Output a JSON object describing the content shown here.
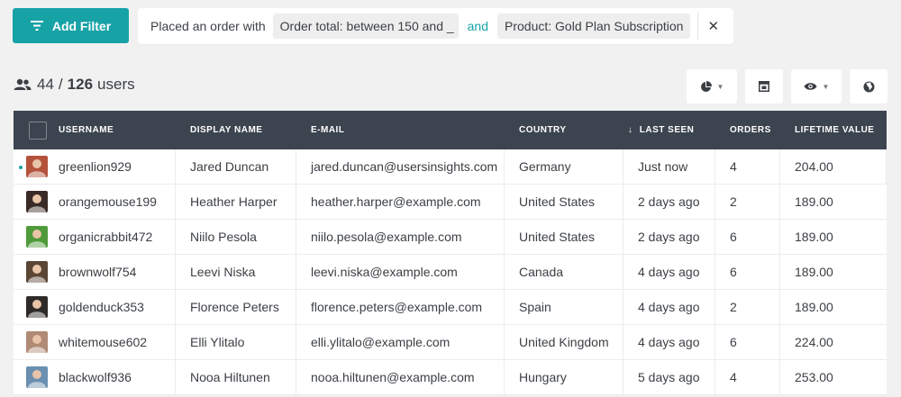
{
  "toolbar": {
    "add_filter_label": "Add Filter"
  },
  "filter": {
    "prefix": "Placed an order with",
    "chips": [
      "Order total: between 150 and _",
      "Product: Gold Plan Subscription"
    ],
    "joiner": "and",
    "close_glyph": "✕"
  },
  "summary": {
    "shown": "44",
    "separator": "/",
    "total": "126",
    "unit": "users"
  },
  "icons": {
    "users": "users-icon",
    "filter": "filter-icon",
    "pie": "pie-chart-icon",
    "columns": "table-layout-icon",
    "eye": "eye-icon",
    "globe": "globe-icon"
  },
  "colors": {
    "accent": "#17a2a6",
    "header_bg": "#3c444f",
    "page_bg": "#f1f1f1"
  },
  "table": {
    "headers": {
      "username": "USERNAME",
      "display_name": "DISPLAY NAME",
      "email": "E-MAIL",
      "country": "COUNTRY",
      "sort_indicator": "↓",
      "last_seen": "LAST SEEN",
      "orders": "ORDERS",
      "lifetime_value": "LIFETIME VALUE"
    },
    "rows": [
      {
        "username": "greenlion929",
        "display_name": "Jared Duncan",
        "email": "jared.duncan@usersinsights.com",
        "country": "Germany",
        "last_seen": "Just now",
        "orders": "4",
        "lifetime_value": "204.00",
        "online": true,
        "avatar_color": "#b5523c"
      },
      {
        "username": "orangemouse199",
        "display_name": "Heather Harper",
        "email": "heather.harper@example.com",
        "country": "United States",
        "last_seen": "2 days ago",
        "orders": "2",
        "lifetime_value": "189.00",
        "online": false,
        "avatar_color": "#3a2a26"
      },
      {
        "username": "organicrabbit472",
        "display_name": "Niilo Pesola",
        "email": "niilo.pesola@example.com",
        "country": "United States",
        "last_seen": "2 days ago",
        "orders": "6",
        "lifetime_value": "189.00",
        "online": false,
        "avatar_color": "#4f9a3a"
      },
      {
        "username": "brownwolf754",
        "display_name": "Leevi Niska",
        "email": "leevi.niska@example.com",
        "country": "Canada",
        "last_seen": "4 days ago",
        "orders": "6",
        "lifetime_value": "189.00",
        "online": false,
        "avatar_color": "#5b4636"
      },
      {
        "username": "goldenduck353",
        "display_name": "Florence Peters",
        "email": "florence.peters@example.com",
        "country": "Spain",
        "last_seen": "4 days ago",
        "orders": "2",
        "lifetime_value": "189.00",
        "online": false,
        "avatar_color": "#2e2a28"
      },
      {
        "username": "whitemouse602",
        "display_name": "Elli Ylitalo",
        "email": "elli.ylitalo@example.com",
        "country": "United Kingdom",
        "last_seen": "4 days ago",
        "orders": "6",
        "lifetime_value": "224.00",
        "online": false,
        "avatar_color": "#b08a74"
      },
      {
        "username": "blackwolf936",
        "display_name": "Nooa Hiltunen",
        "email": "nooa.hiltunen@example.com",
        "country": "Hungary",
        "last_seen": "5 days ago",
        "orders": "4",
        "lifetime_value": "253.00",
        "online": false,
        "avatar_color": "#6a8fb0"
      }
    ]
  }
}
